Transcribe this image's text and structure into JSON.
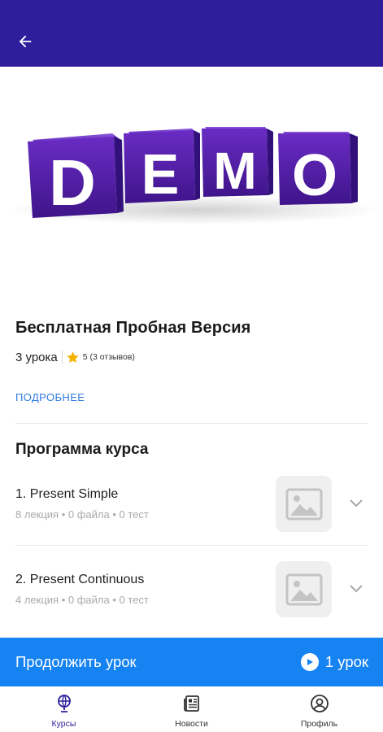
{
  "colors": {
    "appbar": "#2e1e9c",
    "accent": "#1683f3",
    "link": "#2f7be0",
    "cube": "#5a1fb0",
    "star": "#f5b301"
  },
  "appbar": {
    "back_icon": "arrow-left-icon"
  },
  "hero": {
    "letters": [
      "D",
      "E",
      "M",
      "O"
    ]
  },
  "course": {
    "title": "Бесплатная Пробная Версия",
    "lessons_count": "3 урока",
    "rating": "5 (3 отзывов)",
    "more_link": "ПОДРОБНЕЕ"
  },
  "program": {
    "title": "Программа курса",
    "lessons": [
      {
        "name": "1. Present Simple",
        "info": "8 лекция • 0 файла • 0 тест"
      },
      {
        "name": "2. Present Continuous",
        "info": "4 лекция • 0 файла • 0 тест"
      }
    ]
  },
  "continue": {
    "label": "Продолжить урок",
    "count": "1 урок"
  },
  "nav": [
    {
      "label": "Курсы",
      "icon": "globe-icon",
      "active": true
    },
    {
      "label": "Новости",
      "icon": "newspaper-icon",
      "active": false
    },
    {
      "label": "Профиль",
      "icon": "profile-icon",
      "active": false
    }
  ]
}
